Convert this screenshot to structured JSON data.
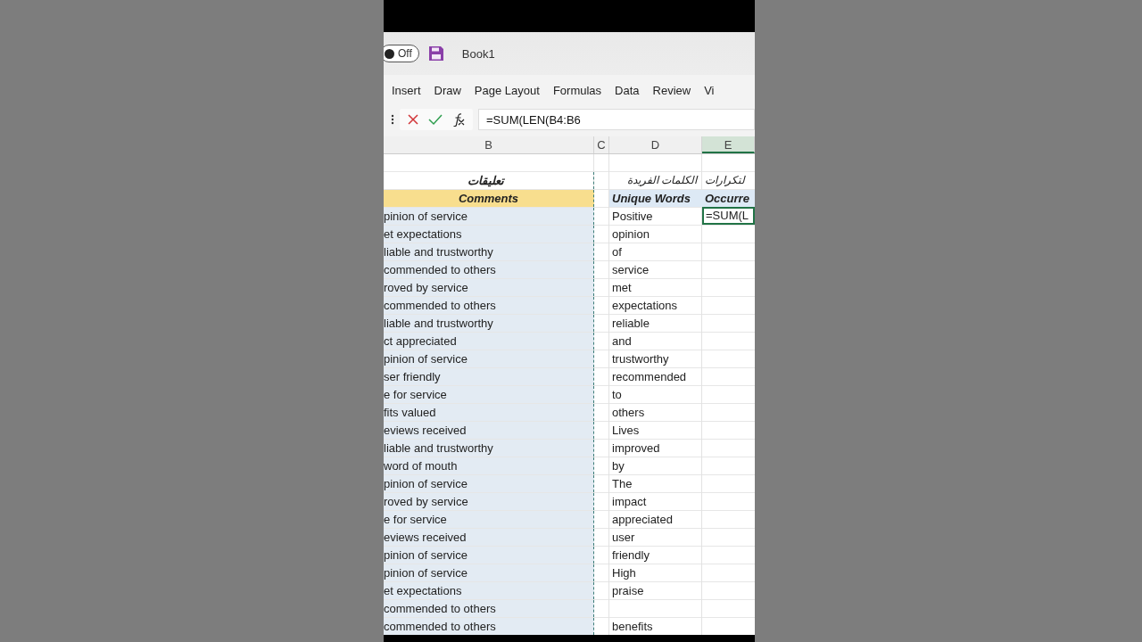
{
  "title_bar": {
    "autosave": {
      "label": "Off",
      "on": false
    },
    "title": "Book1"
  },
  "ribbon_tabs": [
    {
      "label": "Insert"
    },
    {
      "label": "Draw"
    },
    {
      "label": "Page Layout"
    },
    {
      "label": "Formulas"
    },
    {
      "label": "Data"
    },
    {
      "label": "Review"
    },
    {
      "label": "Vi"
    }
  ],
  "formula_bar": {
    "value": "=SUM(LEN(B4:B6"
  },
  "columns": [
    {
      "label": "B",
      "selected": false
    },
    {
      "label": "C",
      "selected": false
    },
    {
      "label": "D",
      "selected": false
    },
    {
      "label": "E",
      "selected": true
    }
  ],
  "arabic_headers": {
    "b": "تعليقات",
    "d": "الكلمات الفريدة",
    "e": "لتكرارات"
  },
  "headers": {
    "b": "Comments",
    "d": "Unique Words",
    "e": "Occurre"
  },
  "rows": [
    {
      "b": "pinion of service",
      "d": "Positive",
      "e": "=SUM(L",
      "selected": true
    },
    {
      "b": "et expectations",
      "d": "opinion",
      "selected": false
    },
    {
      "b": "liable and trustworthy",
      "d": "of",
      "selected": false
    },
    {
      "b": "commended to others",
      "d": "service",
      "selected": false
    },
    {
      "b": "roved by service",
      "d": "met",
      "selected": false
    },
    {
      "b": "commended to others",
      "d": "expectations",
      "selected": false
    },
    {
      "b": "liable and trustworthy",
      "d": "reliable",
      "selected": false
    },
    {
      "b": "ct appreciated",
      "d": "and",
      "selected": false
    },
    {
      "b": "pinion of service",
      "d": "trustworthy",
      "selected": false
    },
    {
      "b": "ser friendly",
      "d": "recommended",
      "selected": false
    },
    {
      "b": "e for service",
      "d": "to",
      "selected": false
    },
    {
      "b": "fits valued",
      "d": "others",
      "selected": false
    },
    {
      "b": "eviews received",
      "d": "Lives",
      "selected": false
    },
    {
      "b": "liable and trustworthy",
      "d": "improved",
      "selected": false
    },
    {
      "b": "word of mouth",
      "d": "by",
      "selected": false
    },
    {
      "b": "pinion of service",
      "d": "The",
      "selected": false
    },
    {
      "b": "roved by service",
      "d": "impact",
      "selected": false
    },
    {
      "b": "e for service",
      "d": "appreciated",
      "selected": false
    },
    {
      "b": "eviews received",
      "d": "user",
      "selected": false
    },
    {
      "b": "pinion of service",
      "d": "friendly",
      "selected": false
    },
    {
      "b": "pinion of service",
      "d": "High",
      "selected": false
    },
    {
      "b": "et expectations",
      "d": "praise",
      "selected": false
    },
    {
      "b": "commended to others",
      "selected": false
    },
    {
      "b": "commended to others",
      "d": "benefits",
      "selected": false
    }
  ]
}
